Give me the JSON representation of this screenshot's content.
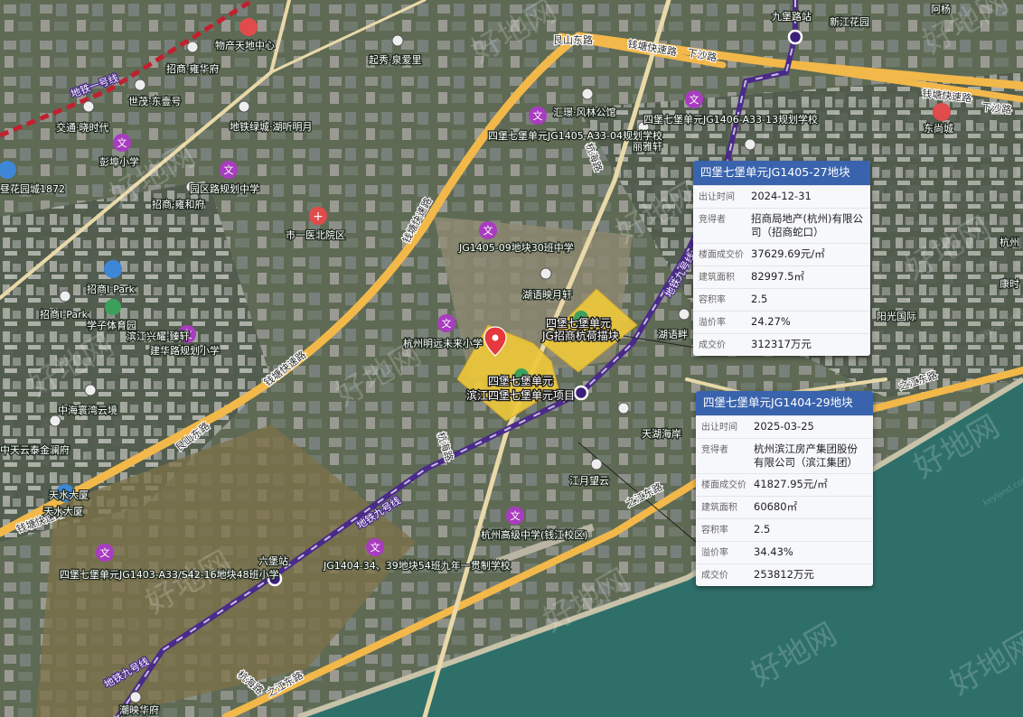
{
  "map": {
    "roads": {
      "liangshan_east": "艮山东路",
      "qiantang_expressway": "钱塘快速路",
      "xiasha_road": "下沙路",
      "hanghai_road": "杭海路",
      "zhijiang_east": "之江东路"
    },
    "metro": {
      "line1": "地铁一号线",
      "line9": "地铁九号线",
      "station_jiubao": "九堡路站",
      "station_liubao": "六堡站"
    },
    "pois": [
      "物产天地中心",
      "招商·雍华府",
      "起秀·泉爱里",
      "世茂·东壹号",
      "交通·晓时代",
      "地铁绿城·湖听明月",
      "彭埠小学",
      "昼花园城1872",
      "园区路规划中学",
      "招商·雍和府",
      "市一医北院区",
      "汇璟·风林公馆",
      "四堡七堡单元JG1405-A33-04规划学校",
      "四堡七堡单元JG1406-A33-13规划学校",
      "丽雅轩",
      "东尚城",
      "新江花园",
      "阿杨",
      "JG1405-09地块30班中学",
      "湖语映月轩",
      "招商I-Park",
      "招商I-Park",
      "学子体育园",
      "滨江兴耀·臻轩",
      "建华路规划小学",
      "杭州明远未来小学",
      "湖语畔",
      "中海寰湾云境",
      "中天云泰金澜府",
      "天水大厦",
      "天水大厦",
      "天湖海岸",
      "江月望云",
      "杭州高级中学(钱江校区)",
      "JG1404-34、39地块54班九年一贯制学校",
      "四堡七堡单元JG1403-A33/S42-16地块48班小学",
      "潮映华府",
      "阳光国际",
      "杭州",
      "康时"
    ],
    "plots": {
      "plot_a_name_1": "四堡七堡单元",
      "plot_a_name_2": "JG招商杭荷描块",
      "plot_b_name_1": "四堡七堡单元",
      "plot_b_name_2": "滨江四堡七堡单元项目"
    },
    "watermark": "好地网",
    "watermark_url": "keyland.com.cn"
  },
  "cards": [
    {
      "title": "四堡七堡单元JG1405-27地块",
      "rows": [
        {
          "k": "出让时间",
          "v": "2024-12-31"
        },
        {
          "k": "竞得者",
          "v": "招商局地产(杭州)有限公司（招商蛇口）"
        },
        {
          "k": "楼面成交价",
          "v": "37629.69元/㎡"
        },
        {
          "k": "建筑面积",
          "v": "82997.5㎡"
        },
        {
          "k": "容积率",
          "v": "2.5"
        },
        {
          "k": "溢价率",
          "v": "24.27%"
        },
        {
          "k": "成交价",
          "v": "312317万元"
        }
      ]
    },
    {
      "title": "四堡七堡单元JG1404-29地块",
      "rows": [
        {
          "k": "出让时间",
          "v": "2025-03-25"
        },
        {
          "k": "竞得者",
          "v": "杭州滨江房产集团股份有限公司（滨江集团）"
        },
        {
          "k": "楼面成交价",
          "v": "41827.95元/㎡"
        },
        {
          "k": "建筑面积",
          "v": "60680㎡"
        },
        {
          "k": "容积率",
          "v": "2.5"
        },
        {
          "k": "溢价率",
          "v": "34.43%"
        },
        {
          "k": "成交价",
          "v": "253812万元"
        }
      ]
    }
  ],
  "colors": {
    "road": "#f3b84a",
    "metro": "#4a2a8a",
    "plot": "#efc93a",
    "card_header": "#3a63ad",
    "river": "#2f6f6a"
  }
}
